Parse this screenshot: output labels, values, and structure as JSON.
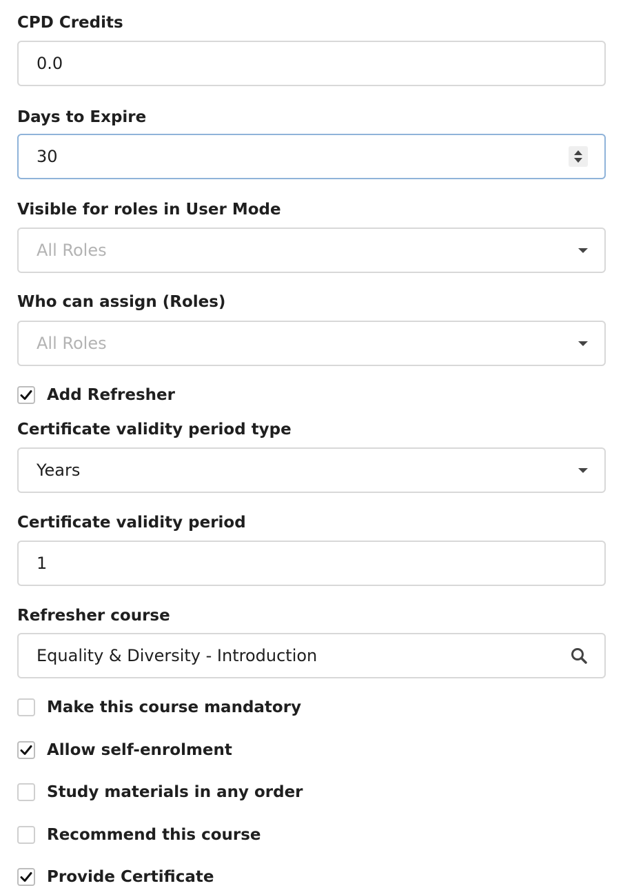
{
  "cpd_credits": {
    "label": "CPD Credits",
    "value": "0.0"
  },
  "days_to_expire": {
    "label": "Days to Expire",
    "value": "30"
  },
  "visible_roles": {
    "label": "Visible for roles in User Mode",
    "placeholder": "All Roles"
  },
  "assign_roles": {
    "label": "Who can assign (Roles)",
    "placeholder": "All Roles"
  },
  "add_refresher": {
    "label": "Add Refresher",
    "checked": true
  },
  "validity_type": {
    "label": "Certificate validity period type",
    "value": "Years"
  },
  "validity_period": {
    "label": "Certificate validity period",
    "value": "1"
  },
  "refresher_course": {
    "label": "Refresher course",
    "value": "Equality & Diversity - Introduction",
    "icon": "search-icon"
  },
  "options": [
    {
      "label": "Make this course mandatory",
      "checked": false
    },
    {
      "label": "Allow self-enrolment",
      "checked": true
    },
    {
      "label": "Study materials in any order",
      "checked": false
    },
    {
      "label": "Recommend this course",
      "checked": false
    },
    {
      "label": "Provide Certificate",
      "checked": true
    }
  ],
  "colors": {
    "focus_border": "#8fb3d9",
    "border": "#d8d8d8",
    "placeholder": "#b3b3b3"
  }
}
